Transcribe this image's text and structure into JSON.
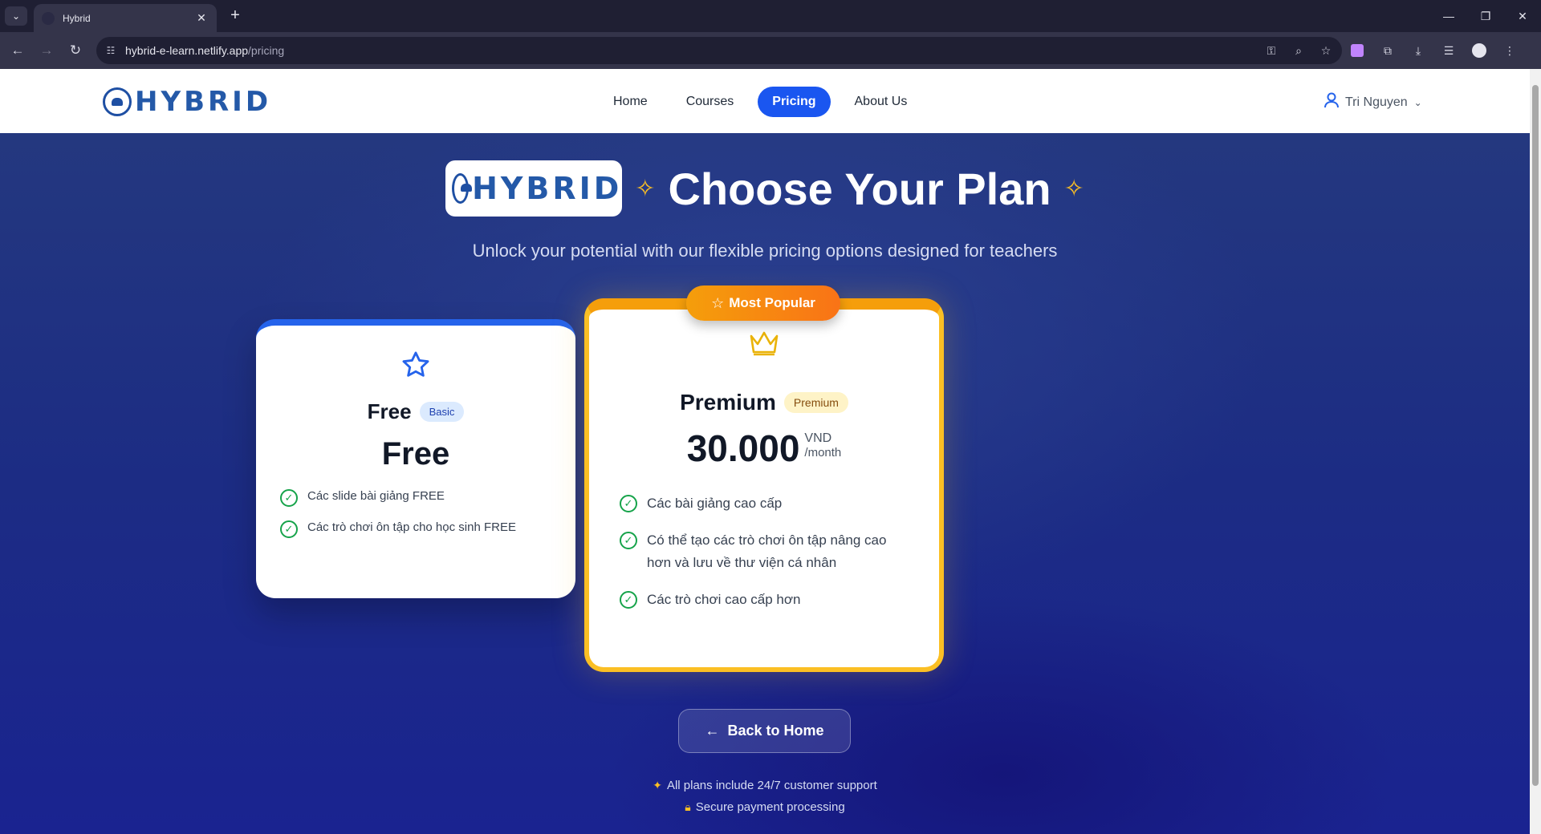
{
  "browser": {
    "tab_title": "Hybrid",
    "url_host": "hybrid-e-learn.netlify.app",
    "url_path": "/pricing"
  },
  "header": {
    "logo_text": "HYBRID",
    "nav": [
      "Home",
      "Courses",
      "Pricing",
      "About Us"
    ],
    "active_nav": "Pricing",
    "user_name": "Tri Nguyen"
  },
  "hero": {
    "logo_text": "HYBRID",
    "title": "Choose Your Plan",
    "subtitle": "Unlock your potential with our flexible pricing options designed for teachers"
  },
  "plans": {
    "free": {
      "name": "Free",
      "tag": "Basic",
      "price": "Free",
      "features": [
        "Các slide bài giảng FREE",
        "Các trò chơi ôn tập cho học sinh FREE"
      ]
    },
    "premium": {
      "badge": "Most Popular",
      "name": "Premium",
      "tag": "Premium",
      "price": "30.000",
      "currency": "VND",
      "period": "/month",
      "features": [
        "Các bài giảng cao cấp",
        "Có thể tạo các trò chơi ôn tập nâng cao hơn và lưu về thư viện cá nhân",
        "Các trò chơi cao cấp hơn"
      ]
    }
  },
  "back_button": "Back to Home",
  "notes": [
    "All plans include 24/7 customer support",
    "Secure payment processing"
  ],
  "colors": {
    "accent": "#1a56f0",
    "gold": "#fbbf24",
    "check": "#16a34a",
    "hero_bg": "#1c2c84"
  }
}
